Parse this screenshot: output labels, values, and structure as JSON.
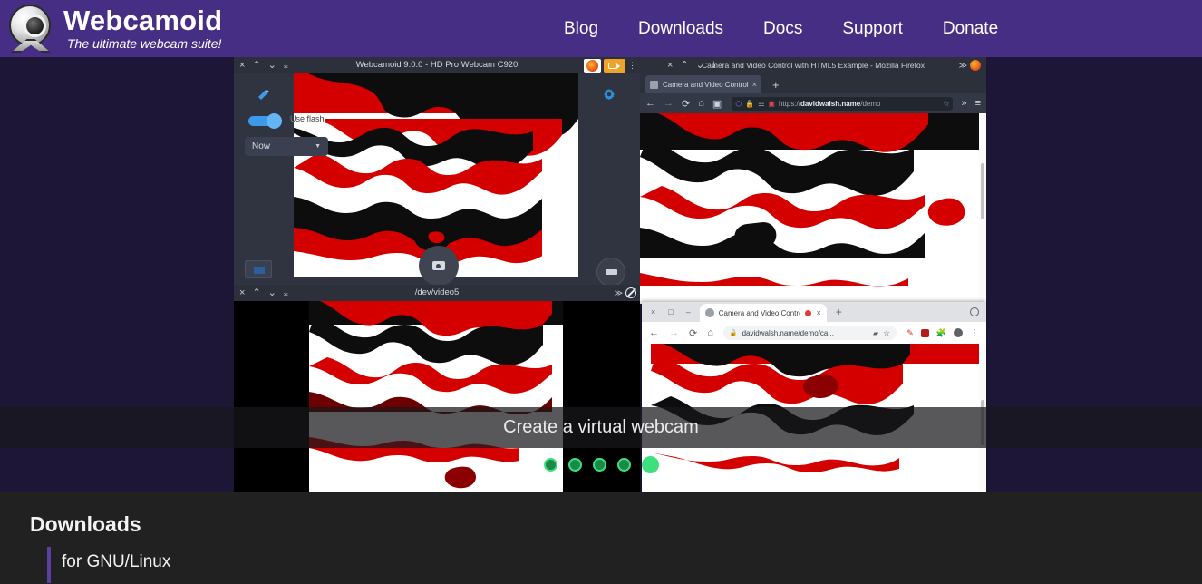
{
  "header": {
    "brand_title": "Webcamoid",
    "brand_tagline": "The ultimate webcam suite!",
    "logo_icon": "webcam-logo-icon",
    "background_color": "#452e84",
    "nav": [
      {
        "label": "Blog",
        "name": "nav-link-blog"
      },
      {
        "label": "Downloads",
        "name": "nav-link-downloads"
      },
      {
        "label": "Docs",
        "name": "nav-link-docs"
      },
      {
        "label": "Support",
        "name": "nav-link-support"
      },
      {
        "label": "Donate",
        "name": "nav-link-donate"
      }
    ]
  },
  "carousel": {
    "caption": "Create a virtual webcam",
    "background_color": "#1d1637",
    "dots": {
      "total": 5,
      "active_index": 4
    },
    "accent_color": "#3ee07e"
  },
  "webcamoid_window": {
    "title": "Webcamoid 9.0.0 - HD Pro Webcam C920",
    "window_buttons": {
      "close": "×",
      "minimize": "⌃",
      "maximize": "⌄",
      "shade": "⤓"
    },
    "gear_icon": "gear-icon",
    "magic_wand_icon": "magic-wand-icon",
    "flash_toggle_label": "Use flash",
    "flash_toggle_state": "on",
    "timing_select_value": "Now",
    "capture_button_icon": "camera-shutter-icon",
    "record_button_icon": "record-video-icon",
    "thumbnail_icon": "last-capture-thumbnail"
  },
  "video5_window": {
    "title": "/dev/video5",
    "window_buttons": {
      "close": "×",
      "minimize": "⌃",
      "maximize": "⌄",
      "shade": "⤓"
    },
    "right_icons": [
      "collapse-icon",
      "no-entry-icon"
    ]
  },
  "firefox_window": {
    "title": "Camera and Video Control with HTML5 Example - Mozilla Firefox",
    "tab_label": "Camera and Video Control",
    "tab_close": "×",
    "new_tab": "+",
    "url_prefix": "https://",
    "url_domain": "davidwalsh.name",
    "url_path": "/demo",
    "toolbar_icons": [
      "back-icon",
      "forward-icon",
      "reload-icon",
      "home-icon",
      "library-icon"
    ],
    "urlbar_icons": [
      "shield-icon",
      "lock-icon",
      "permissions-icon",
      "camera-sharing-icon"
    ],
    "bookmark_icon": "star-icon",
    "overflow_icon": "chevron-double-right-icon",
    "menu_icon": "hamburger-menu-icon"
  },
  "chrome_window": {
    "tab_label": "Camera and Video Contro",
    "tab_close": "×",
    "new_tab": "+",
    "url": "davidwalsh.name/demo/ca...",
    "window_buttons": {
      "close": "×",
      "maximize": "□",
      "minimize": "–"
    },
    "toolbar_icons": [
      "back-icon",
      "forward-icon",
      "reload-icon",
      "home-icon"
    ],
    "omnibox_icons": [
      "lock-icon",
      "camera-sharing-icon",
      "star-icon"
    ],
    "extension_icons": [
      "pen-extension-icon",
      "ublock-extension-icon",
      "puzzle-extensions-icon",
      "profile-avatar-icon",
      "three-dot-menu-icon"
    ],
    "settings_icon": "settings-circle-icon"
  },
  "downloads": {
    "title": "Downloads",
    "subtitle": "for GNU/Linux",
    "accent_color": "#5c3fa0",
    "background_color": "#212121"
  }
}
